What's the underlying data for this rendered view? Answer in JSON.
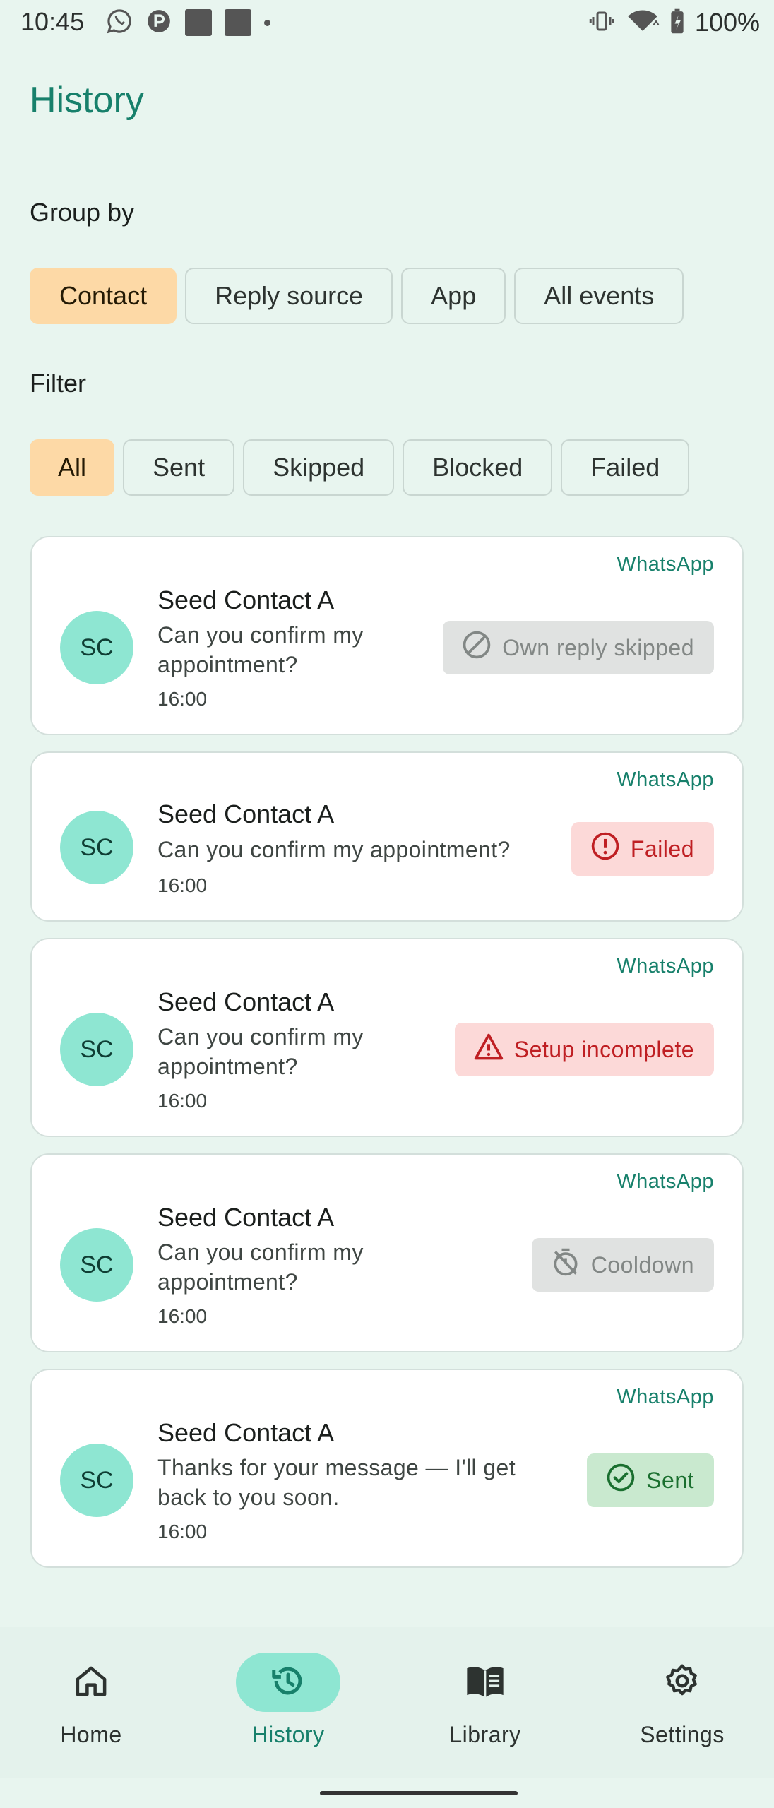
{
  "status_bar": {
    "time": "10:45",
    "battery": "100%"
  },
  "page": {
    "title": "History"
  },
  "group_by": {
    "label": "Group by",
    "chips": [
      {
        "label": "Contact",
        "selected": true
      },
      {
        "label": "Reply source",
        "selected": false
      },
      {
        "label": "App",
        "selected": false
      },
      {
        "label": "All events",
        "selected": false
      }
    ]
  },
  "filter": {
    "label": "Filter",
    "chips": [
      {
        "label": "All",
        "selected": true
      },
      {
        "label": "Sent",
        "selected": false
      },
      {
        "label": "Skipped",
        "selected": false
      },
      {
        "label": "Blocked",
        "selected": false
      },
      {
        "label": "Failed",
        "selected": false
      }
    ]
  },
  "items": [
    {
      "app": "WhatsApp",
      "initials": "SC",
      "contact": "Seed Contact A",
      "message_lines": [
        "Can you confirm my",
        "appointment?"
      ],
      "time": "16:00",
      "status": "Own reply skipped",
      "status_icon": "block-icon",
      "status_color": "#828785"
    },
    {
      "app": "WhatsApp",
      "initials": "SC",
      "contact": "Seed Contact A",
      "message_lines": [
        "Can you confirm my appointment?"
      ],
      "time": "16:00",
      "status": "Failed",
      "status_icon": "error-icon",
      "status_color": "#bf1f23"
    },
    {
      "app": "WhatsApp",
      "initials": "SC",
      "contact": "Seed Contact A",
      "message_lines": [
        "Can you confirm my",
        "appointment?"
      ],
      "time": "16:00",
      "status": "Setup incomplete",
      "status_icon": "warning-icon",
      "status_color": "#bf1f23"
    },
    {
      "app": "WhatsApp",
      "initials": "SC",
      "contact": "Seed Contact A",
      "message_lines": [
        "Can you confirm my",
        "appointment?"
      ],
      "time": "16:00",
      "status": "Cooldown",
      "status_icon": "timer-off-icon",
      "status_color": "#828785"
    },
    {
      "app": "WhatsApp",
      "initials": "SC",
      "contact": "Seed Contact A",
      "message_lines": [
        "Thanks for your message — I'll get",
        "back to you soon."
      ],
      "time": "16:00",
      "status": "Sent",
      "status_icon": "check-circle-icon",
      "status_color": "#1a6f2f"
    }
  ],
  "nav": [
    {
      "label": "Home",
      "icon": "home-icon",
      "active": false
    },
    {
      "label": "History",
      "icon": "history-icon",
      "active": true
    },
    {
      "label": "Library",
      "icon": "book-icon",
      "active": false
    },
    {
      "label": "Settings",
      "icon": "gear-icon",
      "active": false
    }
  ]
}
